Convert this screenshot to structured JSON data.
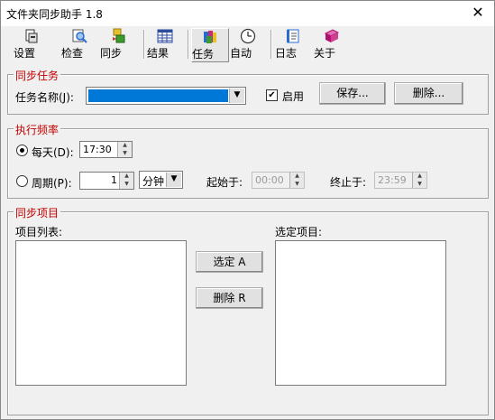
{
  "window": {
    "title": "文件夹同步助手 1.8",
    "close_glyph": "✕"
  },
  "toolbar": {
    "items": [
      {
        "label": "设置",
        "icon": "settings-icon",
        "color": "#333333"
      },
      {
        "label": "检查",
        "icon": "inspect-icon",
        "color": "#2a6bd0"
      },
      {
        "label": "同步",
        "icon": "sync-icon",
        "color": "#3d9b2d"
      },
      {
        "label": "结果",
        "icon": "table-icon",
        "color": "#2c4d9e"
      },
      {
        "label": "任务",
        "icon": "task-icon",
        "color": "#c03070"
      },
      {
        "label": "自动",
        "icon": "clock-icon",
        "color": "#333333"
      },
      {
        "label": "日志",
        "icon": "log-icon",
        "color": "#2a6bd0"
      },
      {
        "label": "关于",
        "icon": "book-icon",
        "color": "#b01070"
      }
    ],
    "active_index": 4
  },
  "sync_task": {
    "title": "同步任务",
    "name_label": "任务名称(J):",
    "enable_label": "启用",
    "enable_checked": true,
    "save_button": "保存...",
    "delete_button": "删除..."
  },
  "frequency": {
    "title": "执行频率",
    "daily_label": "每天(D):",
    "daily_time": "17:30",
    "period_label": "周期(P):",
    "period_value": "1",
    "period_unit": "分钟",
    "start_label": "起始于:",
    "start_time": "00:00",
    "end_label": "终止于:",
    "end_time": "23:59",
    "selected": "daily"
  },
  "sync_items": {
    "title": "同步项目",
    "list_label": "项目列表:",
    "selected_label": "选定项目:",
    "select_button": "选定 A",
    "remove_button": "删除 R"
  },
  "colors": {
    "group_title": "#c00000",
    "selection": "#0078d7"
  }
}
